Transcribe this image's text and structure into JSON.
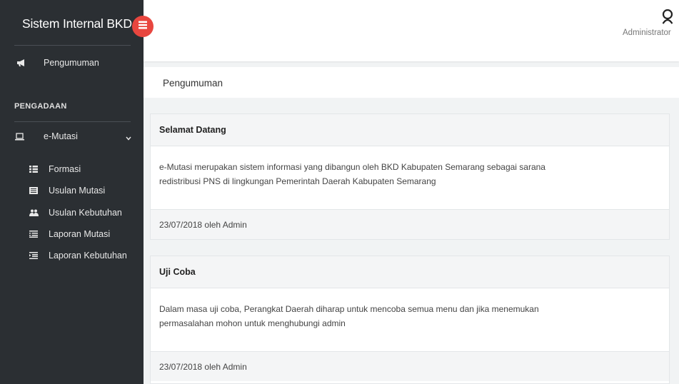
{
  "app": {
    "title": "Sistem Internal BKD",
    "toggle_icon": "menu-toggle-icon",
    "toggle_color": "#e8463f"
  },
  "sidebar": {
    "background": "#2b2f33",
    "top_item": {
      "label": "Pengumuman",
      "icon": "megaphone-icon"
    },
    "section_header": "PENGADAAN",
    "group": {
      "label": "e-Mutasi",
      "icon": "laptop-icon",
      "expanded": true
    },
    "items": [
      {
        "label": "Formasi",
        "icon": "grid-icon"
      },
      {
        "label": "Usulan Mutasi",
        "icon": "list-box-icon"
      },
      {
        "label": "Usulan Kebutuhan",
        "icon": "users-icon"
      },
      {
        "label": "Laporan Mutasi",
        "icon": "list-icon"
      },
      {
        "label": "Laporan Kebutuhan",
        "icon": "indent-list-icon"
      }
    ]
  },
  "header": {
    "user_label": "Administrator",
    "user_icon": "user-icon"
  },
  "page": {
    "title": "Pengumuman"
  },
  "announcements": [
    {
      "title": "Selamat Datang",
      "body_line1": "e-Mutasi merupakan sistem informasi yang dibangun oleh BKD Kabupaten Semarang sebagai sarana",
      "body_line2": "redistribusi PNS di lingkungan Pemerintah Daerah Kabupaten Semarang",
      "meta": "23/07/2018 oleh Admin"
    },
    {
      "title": "Uji Coba",
      "body_line1": "Dalam masa uji coba, Perangkat Daerah diharap untuk mencoba semua menu dan jika menemukan",
      "body_line2": "permasalahan mohon untuk menghubungi admin",
      "meta": "23/07/2018 oleh Admin"
    }
  ]
}
